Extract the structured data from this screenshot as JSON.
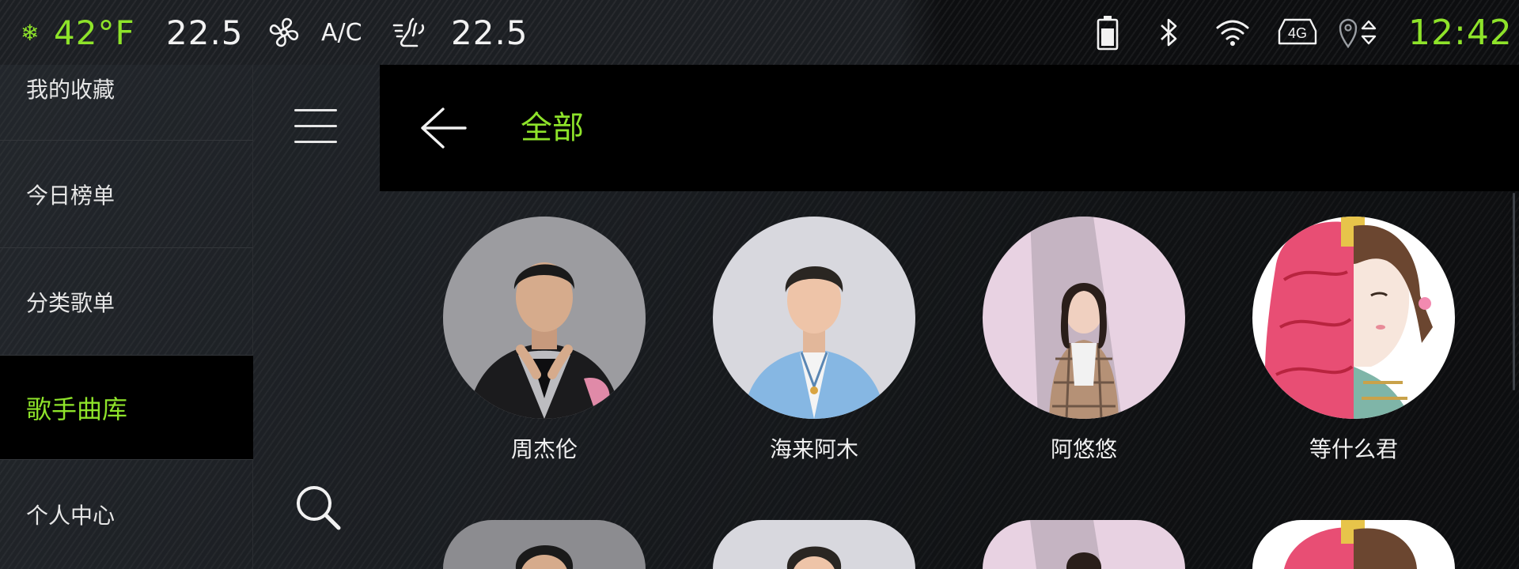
{
  "status": {
    "outside_temp": "42°F",
    "temp_left": "22.5",
    "ac_label": "A/C",
    "temp_right": "22.5",
    "network": "4G",
    "time": "12:42",
    "icons": [
      "snowflake-icon",
      "fan-icon",
      "seat-airflow-icon",
      "battery-icon",
      "bluetooth-icon",
      "wifi-icon",
      "lte-icon",
      "location-icon"
    ]
  },
  "menu": {
    "items": [
      {
        "label": "我的收藏"
      },
      {
        "label": "今日榜单"
      },
      {
        "label": "分类歌单"
      },
      {
        "label": "歌手曲库"
      },
      {
        "label": "个人中心"
      }
    ],
    "active_index": 3
  },
  "header": {
    "title": "全部"
  },
  "artists": [
    {
      "name": "周杰伦"
    },
    {
      "name": "海来阿木"
    },
    {
      "name": "阿悠悠"
    },
    {
      "name": "等什么君"
    }
  ],
  "colors": {
    "accent": "#8ee32a",
    "background": "#141619",
    "header_bg": "#000000",
    "text": "#e8e8e8"
  }
}
